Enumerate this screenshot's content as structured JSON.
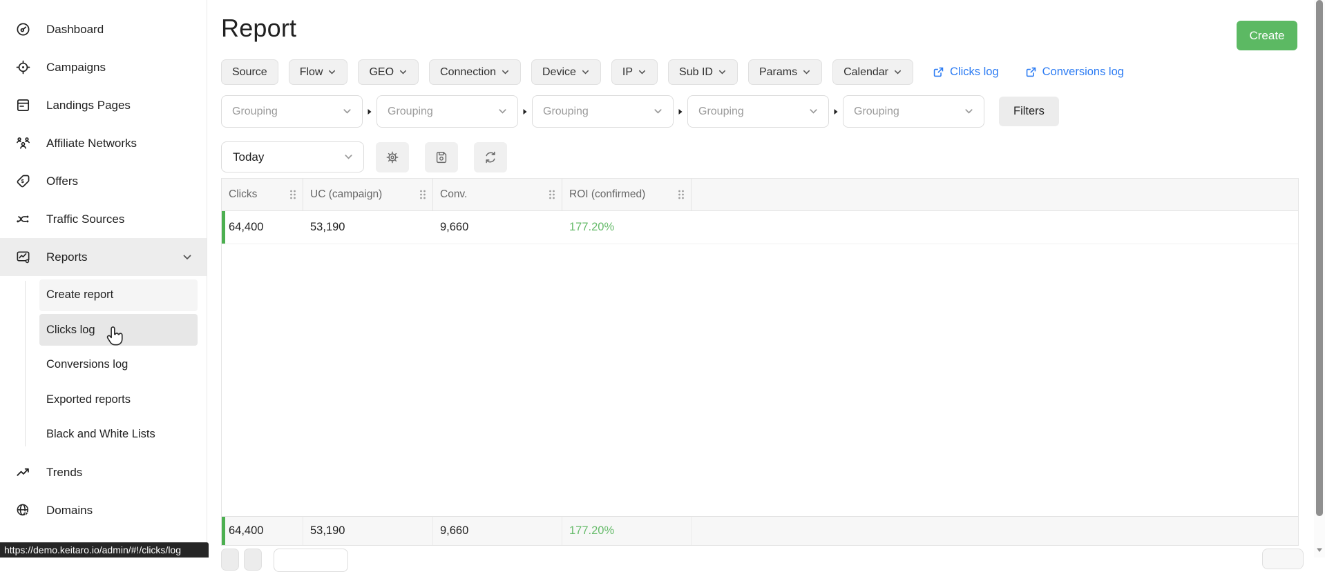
{
  "colors": {
    "accent_green": "#5cb963",
    "roi_green": "#66bb6a",
    "link_blue": "#2b7bf3",
    "row_marker_green": "#4caf50",
    "statusbar_bg": "#262626"
  },
  "sidebar": {
    "items": [
      {
        "label": "Dashboard",
        "icon": "dashboard-gauge-icon"
      },
      {
        "label": "Campaigns",
        "icon": "campaigns-target-icon"
      },
      {
        "label": "Landings Pages",
        "icon": "landings-document-icon"
      },
      {
        "label": "Affiliate Networks",
        "icon": "affiliate-people-icon"
      },
      {
        "label": "Offers",
        "icon": "offers-tag-icon"
      },
      {
        "label": "Traffic Sources",
        "icon": "traffic-branch-icon"
      },
      {
        "label": "Reports",
        "icon": "reports-chart-gear-icon",
        "state": "active-expanded"
      },
      {
        "label": "Trends",
        "icon": "trends-arrow-icon"
      },
      {
        "label": "Domains",
        "icon": "domains-globe-icon"
      }
    ],
    "subitems": [
      {
        "label": "Create report"
      },
      {
        "label": "Clicks log",
        "state": "hovered"
      },
      {
        "label": "Conversions log"
      },
      {
        "label": "Exported reports"
      },
      {
        "label": "Black and White Lists"
      }
    ]
  },
  "statusbar": {
    "url": "https://demo.keitaro.io/admin/#!/clicks/log"
  },
  "header": {
    "title": "Report",
    "create_label": "Create"
  },
  "filters": {
    "chips": [
      {
        "label": "Source"
      },
      {
        "label": "Flow"
      },
      {
        "label": "GEO"
      },
      {
        "label": "Connection"
      },
      {
        "label": "Device"
      },
      {
        "label": "IP"
      },
      {
        "label": "Sub ID"
      },
      {
        "label": "Params"
      },
      {
        "label": "Calendar"
      }
    ],
    "links": {
      "clicks_log": "Clicks log",
      "conversions_log": "Conversions log"
    }
  },
  "grouping": {
    "placeholder": "Grouping",
    "filters_label": "Filters"
  },
  "toolbar": {
    "date_range": "Today",
    "icons": [
      "settings-gear-icon",
      "save-floppy-icon",
      "refresh-icon"
    ]
  },
  "table": {
    "columns": [
      {
        "label": "Clicks"
      },
      {
        "label": "UC (campaign)"
      },
      {
        "label": "Conv."
      },
      {
        "label": "ROI (confirmed)"
      }
    ],
    "rows": [
      {
        "cells": [
          "64,400",
          "53,190",
          "9,660",
          "177.20%"
        ]
      }
    ],
    "totals": {
      "cells": [
        "64,400",
        "53,190",
        "9,660",
        "177.20%"
      ]
    }
  }
}
